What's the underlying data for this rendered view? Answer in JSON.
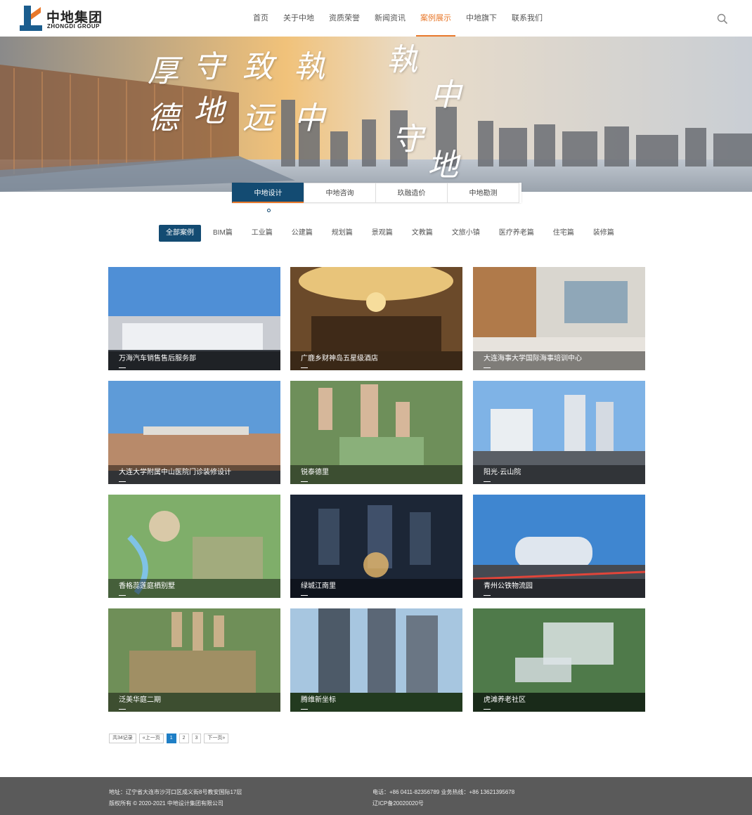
{
  "header": {
    "logo_cn": "中地集团",
    "logo_en": "ZHONGDI GROUP",
    "nav": [
      "首页",
      "关于中地",
      "资质荣誉",
      "新闻资讯",
      "案例展示",
      "中地旗下",
      "联系我们"
    ],
    "active_nav": "案例展示"
  },
  "banner": {
    "calligraphy": [
      "厚",
      "德",
      "守",
      "地",
      "致",
      "远",
      "執",
      "中",
      "執",
      "中",
      "守",
      "地"
    ]
  },
  "tabs": [
    "中地设计",
    "中地咨询",
    "玖融造价",
    "中地勘测"
  ],
  "active_tab": "中地设计",
  "categories": [
    "全部案例",
    "BIM篇",
    "工业篇",
    "公建篇",
    "规划篇",
    "景观篇",
    "文教篇",
    "文旅小镇",
    "医疗养老篇",
    "住宅篇",
    "装修篇"
  ],
  "active_category": "全部案例",
  "cases": [
    {
      "title": "万海汽车销售售后服务部"
    },
    {
      "title": "广鹿乡财神岛五星级酒店"
    },
    {
      "title": "大连海事大学国际海事培训中心"
    },
    {
      "title": "大连大学附属中山医院门诊装修设计"
    },
    {
      "title": "锐泰德里"
    },
    {
      "title": "阳光·云山院"
    },
    {
      "title": "香格蕊莲庭栖别墅"
    },
    {
      "title": "绿城江南里"
    },
    {
      "title": "青州公铁物流园"
    },
    {
      "title": "泛美华庭二期"
    },
    {
      "title": "腾维新坐标"
    },
    {
      "title": "虎滩养老社区"
    }
  ],
  "pager": {
    "total": "共34记录",
    "prev": "«上一页",
    "pages": [
      "1",
      "2",
      "3"
    ],
    "current": "1",
    "next": "下一页»"
  },
  "footer": {
    "address": "地址：辽宁省大连市沙河口区成义街8号教安国际17层",
    "copyright": "版权所有 © 2020-2021 中地设计集团有限公司",
    "phone": "电话：+86 0411-82356789   业务热线：+86 13621395678",
    "icp": "辽ICP备20020020号"
  },
  "colors": {
    "primary": "#134b72",
    "accent": "#e8782b",
    "pager_active": "#1f7fc6",
    "footer": "#5a5a5a"
  }
}
